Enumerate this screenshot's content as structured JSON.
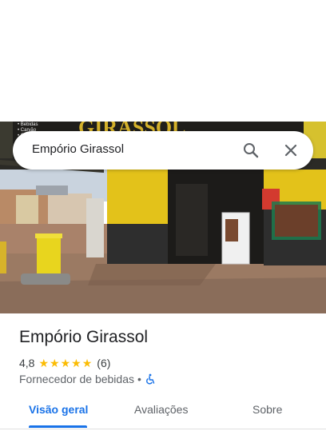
{
  "search": {
    "query": "Empório Girassol"
  },
  "photo": {
    "sign_text": "GIRASSOL"
  },
  "place": {
    "name": "Empório Girassol",
    "rating": "4,8",
    "review_count": "(6)",
    "category": "Fornecedor de bebidas",
    "separator": "•",
    "stars": 5
  },
  "tabs": [
    {
      "label": "Visão geral"
    },
    {
      "label": "Avaliações"
    },
    {
      "label": "Sobre"
    }
  ],
  "colors": {
    "accent": "#1a73e8",
    "star": "#fbbc04"
  }
}
